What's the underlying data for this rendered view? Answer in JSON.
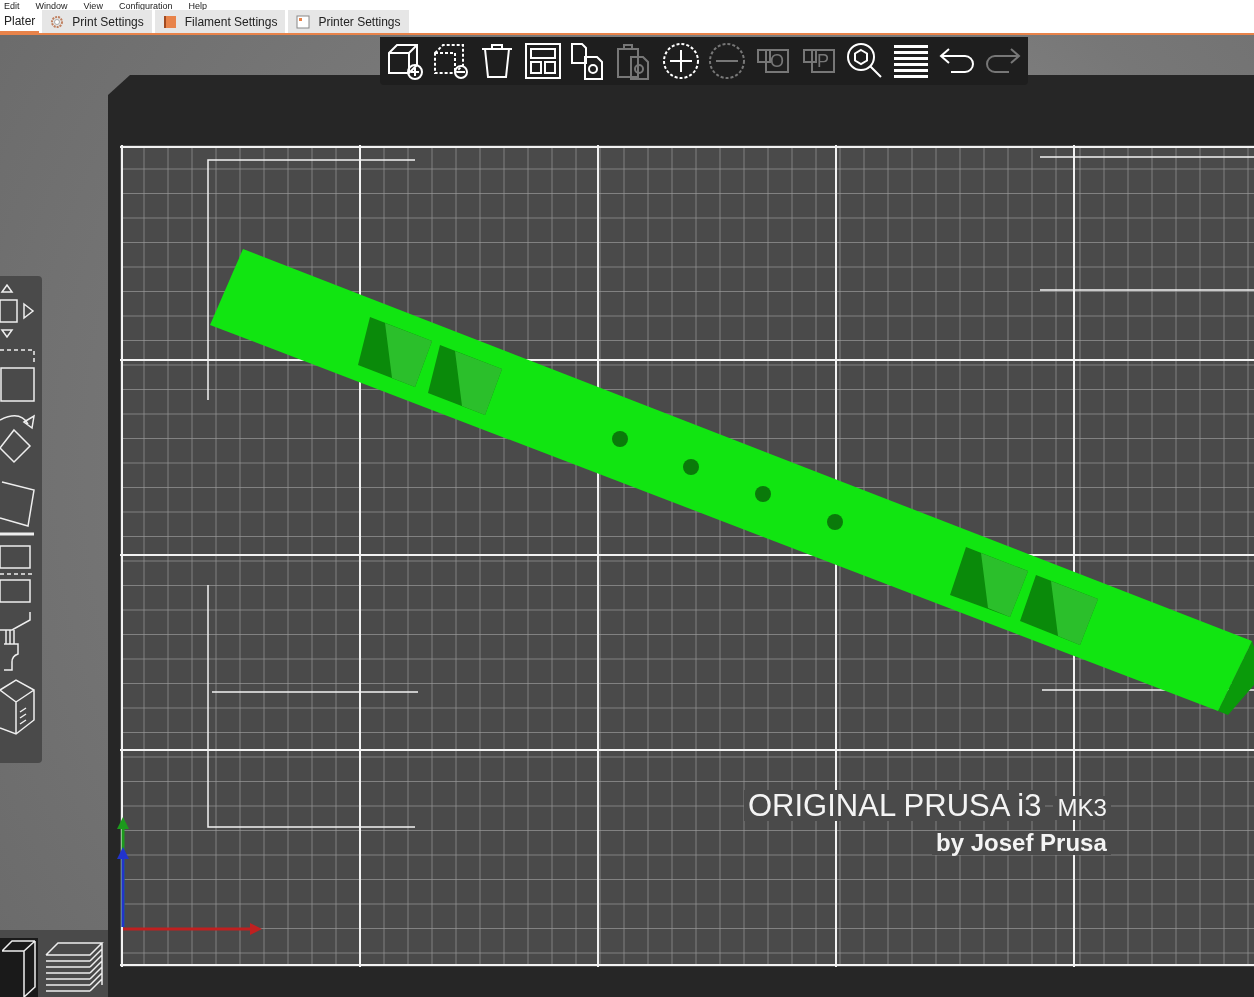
{
  "menu_bar": [
    "Edit",
    "Window",
    "View",
    "Configuration",
    "Help"
  ],
  "tabs": [
    {
      "label": "Plater",
      "kind": "plater",
      "selected": true
    },
    {
      "label": "Print Settings",
      "kind": "print",
      "selected": false
    },
    {
      "label": "Filament Settings",
      "kind": "filament",
      "selected": false
    },
    {
      "label": "Printer Settings",
      "kind": "printer",
      "selected": false
    }
  ],
  "toolbar": [
    {
      "kind": "add",
      "disabled": false
    },
    {
      "kind": "delete",
      "disabled": false
    },
    {
      "kind": "delete_all",
      "disabled": false
    },
    {
      "kind": "arrange",
      "disabled": false
    },
    {
      "kind": "copy",
      "disabled": false
    },
    {
      "kind": "paste",
      "disabled": true
    },
    {
      "kind": "more",
      "disabled": false
    },
    {
      "kind": "fewer",
      "disabled": true
    },
    {
      "kind": "split",
      "label": "O",
      "disabled": true
    },
    {
      "kind": "split",
      "label": "P",
      "disabled": true
    },
    {
      "kind": "search",
      "disabled": false
    },
    {
      "kind": "layers",
      "disabled": false
    },
    {
      "kind": "undo",
      "disabled": false
    },
    {
      "kind": "redo",
      "disabled": true
    }
  ],
  "view_buttons": [
    {
      "kind": "model",
      "selected": true
    },
    {
      "kind": "preview",
      "selected": false
    }
  ],
  "bed_logo": {
    "title": "ORIGINAL PRUSA i3",
    "model": "MK3",
    "maker": "by Josef Prusa"
  }
}
